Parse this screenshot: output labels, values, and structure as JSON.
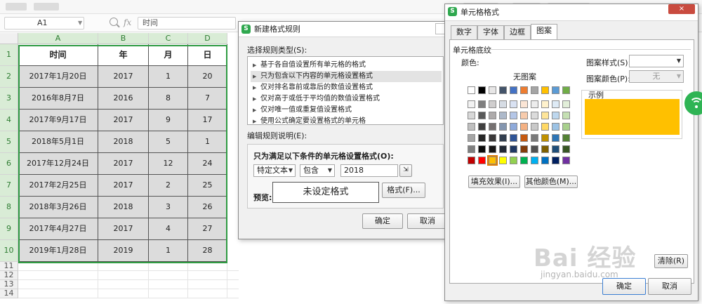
{
  "formula_bar": {
    "name_box": "A1",
    "fx": "fx",
    "content": "时间"
  },
  "sheet": {
    "columns": [
      "A",
      "B",
      "C",
      "D"
    ],
    "rows": [
      "1",
      "2",
      "3",
      "4",
      "5",
      "6",
      "7",
      "8",
      "9",
      "10",
      "11",
      "12",
      "13",
      "14"
    ],
    "header": [
      "时间",
      "年",
      "月",
      "日"
    ],
    "data": [
      [
        "2017年1月20日",
        "2017",
        "1",
        "20"
      ],
      [
        "2016年8月7日",
        "2016",
        "8",
        "7"
      ],
      [
        "2017年9月17日",
        "2017",
        "9",
        "17"
      ],
      [
        "2018年5月1日",
        "2018",
        "5",
        "1"
      ],
      [
        "2017年12月24日",
        "2017",
        "12",
        "24"
      ],
      [
        "2017年2月25日",
        "2017",
        "2",
        "25"
      ],
      [
        "2018年3月26日",
        "2018",
        "3",
        "26"
      ],
      [
        "2017年4月27日",
        "2017",
        "4",
        "27"
      ],
      [
        "2019年1月28日",
        "2019",
        "1",
        "28"
      ]
    ]
  },
  "rule_dialog": {
    "title": "新建格式规则",
    "select_type_label": "选择规则类型(S):",
    "rule_types": [
      "基于各自值设置所有单元格的格式",
      "只为包含以下内容的单元格设置格式",
      "仅对排名靠前或靠后的数值设置格式",
      "仅对高于或低于平均值的数值设置格式",
      "仅对唯一值或重复值设置格式",
      "使用公式确定要设置格式的单元格"
    ],
    "edit_desc_label": "编辑规则说明(E):",
    "condition_label": "只为满足以下条件的单元格设置格式(O):",
    "condition_type": "特定文本",
    "operator": "包含",
    "value": "2018",
    "preview_label": "预览:",
    "preview_text": "未设定格式",
    "format_button": "格式(F)...",
    "ok_button": "确定",
    "cancel_button": "取消"
  },
  "cells_dialog": {
    "title": "单元格格式",
    "close": "×",
    "tabs": [
      "数字",
      "字体",
      "边框",
      "图案"
    ],
    "active_tab": "图案",
    "section_label": "单元格底纹",
    "color_label": "颜色:",
    "no_pattern": "无图案",
    "pattern_style_label": "图案样式(S):",
    "pattern_color_label": "图案颜色(P):",
    "pattern_color_value": "无",
    "sample_label": "示例",
    "fill_effect_button": "填充效果(I)...",
    "more_colors_button": "其他颜色(M)...",
    "clear_button": "清除(R)",
    "ok_button": "确定",
    "cancel_button": "取消",
    "sample_color": "#ffc000",
    "theme_colors_row1": [
      "#ffffff",
      "#000000",
      "#e7e6e6",
      "#44546a",
      "#4472c4",
      "#ed7d31",
      "#a5a5a5",
      "#ffc000",
      "#5b9bd5",
      "#70ad47"
    ],
    "theme_grid": [
      [
        "#f2f2f2",
        "#7f7f7f",
        "#d0cece",
        "#d6dce4",
        "#d9e2f3",
        "#fbe5d5",
        "#ededed",
        "#fff2cc",
        "#deebf6",
        "#e2efd9"
      ],
      [
        "#d8d8d8",
        "#595959",
        "#aeabab",
        "#adb9ca",
        "#b4c6e7",
        "#f7cbac",
        "#dbdbdb",
        "#fee599",
        "#bdd7ee",
        "#c5e0b3"
      ],
      [
        "#bfbfbf",
        "#3f3f3f",
        "#757070",
        "#8496b0",
        "#8eaadb",
        "#f4b183",
        "#c9c9c9",
        "#ffd965",
        "#9cc3e5",
        "#a8d08d"
      ],
      [
        "#a5a5a5",
        "#262626",
        "#3a3838",
        "#323e4f",
        "#2f5496",
        "#c55a11",
        "#7b7b7b",
        "#bf9000",
        "#2e75b5",
        "#538135"
      ],
      [
        "#7f7f7f",
        "#0c0c0c",
        "#171616",
        "#222a35",
        "#1f3864",
        "#833c0b",
        "#525252",
        "#7f6000",
        "#1f4e79",
        "#375623"
      ]
    ],
    "standard_colors": [
      "#c00000",
      "#ff0000",
      "#ffc000",
      "#ffff00",
      "#92d050",
      "#00b050",
      "#00b0f0",
      "#0070c0",
      "#002060",
      "#7030a0"
    ],
    "selected_standard_index": 2
  },
  "watermark": {
    "text": "Bai 经验",
    "sub": "jingyan.baidu.com"
  }
}
